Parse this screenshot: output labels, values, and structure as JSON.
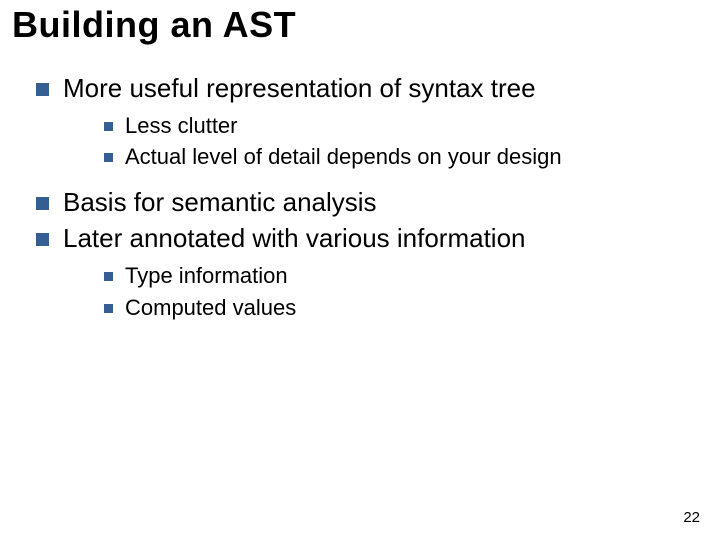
{
  "title": "Building an AST",
  "bullets": [
    {
      "text": "More useful representation of syntax tree",
      "children": [
        {
          "text": "Less clutter"
        },
        {
          "text": "Actual level of detail depends on your design"
        }
      ]
    },
    {
      "text": "Basis for semantic analysis",
      "children": []
    },
    {
      "text": "Later annotated with various information",
      "children": [
        {
          "text": "Type information"
        },
        {
          "text": "Computed values"
        }
      ]
    }
  ],
  "page_number": "22"
}
